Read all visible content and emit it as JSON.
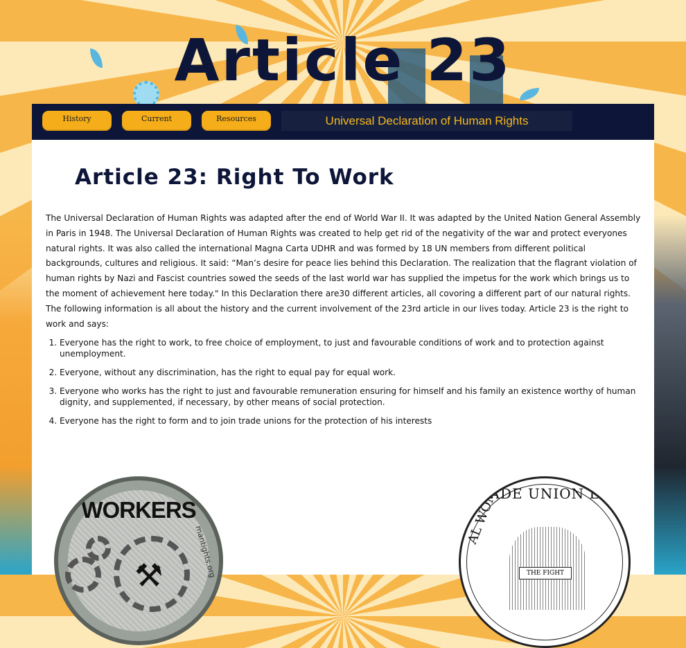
{
  "header": {
    "site_title": "Article 23"
  },
  "nav": {
    "items": [
      {
        "label": "History"
      },
      {
        "label": "Current"
      },
      {
        "label": "Resources"
      }
    ],
    "banner": "Universal Declaration of Human Rights"
  },
  "main": {
    "heading": "Article 23: Right To Work",
    "intro": "The Universal Declaration of Human Rights was adapted after the end of World War II. It was adapted by the United Nation General Assembly in Paris in 1948. The Universal Declaration of Human Rights was created to help get rid of the negativity of the war and protect everyones natural rights. It was also called the international Magna Carta UDHR and was formed by 18 UN members from different political backgrounds, cultures and religious. It said: “Man’s desire for peace lies behind this Declaration. The realization that the flagrant violation of human rights by Nazi and Fascist countries sowed the seeds of the last world war has supplied the impetus for the work which brings us to the moment of achievement here today.\" In this Declaration there are30 different articles, all covoring a different part of our natural rights. The following information is all about the history and the current involvement of the 23rd article in our lives today. Article 23 is the right to work and says:",
    "list": [
      "Everyone has the right to work, to free choice of employment, to just and favourable conditions of work and to protection against unemployment.",
      "Everyone, without any discrimination, has the right to equal pay for equal work.",
      "Everyone who works has the right to just and favourable remuneration ensuring for himself and his family an existence worthy of human dignity, and supplemented, if necessary, by other means of social protection.",
      "Everyone has the right to form and to join trade unions for the protection of his interests"
    ]
  },
  "images": {
    "workers_seal": {
      "word": "WORKERS",
      "side": "mantights.org"
    },
    "union_seal": {
      "arc": "TRADE UNION LEA",
      "side": "AL WOMEN'S",
      "banner": "THE FIGHT"
    }
  }
}
